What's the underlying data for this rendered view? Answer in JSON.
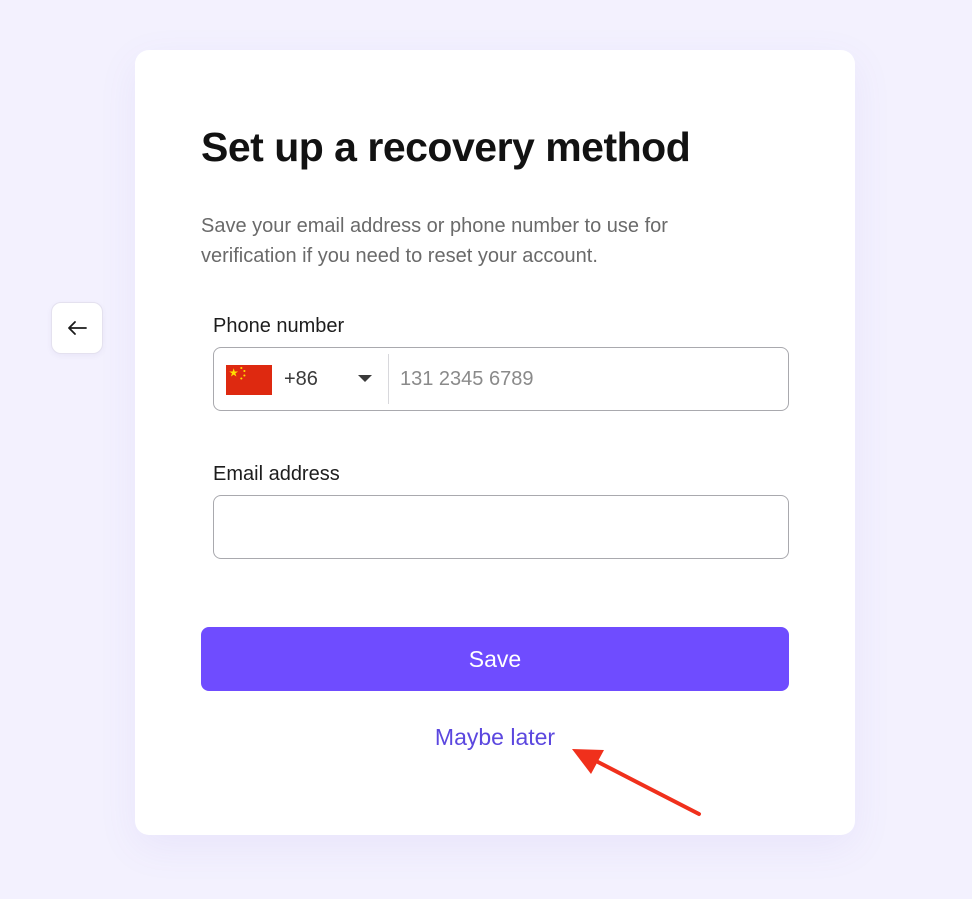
{
  "page": {
    "title": "Set up a recovery method",
    "description": "Save your email address or phone number to use for verification if you need to reset your account."
  },
  "back_button": {
    "icon": "arrow-left-icon"
  },
  "phone": {
    "label": "Phone number",
    "country_flag": "china-flag-icon",
    "dial_code": "+86",
    "dropdown_icon": "chevron-down-icon",
    "placeholder": "131 2345 6789",
    "value": ""
  },
  "email": {
    "label": "Email address",
    "value": ""
  },
  "actions": {
    "save_label": "Save",
    "maybe_later_label": "Maybe later"
  },
  "annotation": {
    "icon": "red-arrow-icon"
  },
  "colors": {
    "background": "#f3f1fe",
    "accent": "#6f4cff",
    "link": "#5b47df",
    "annotation": "#f0301c",
    "flag_red": "#de2910",
    "flag_yellow": "#ffde00"
  }
}
